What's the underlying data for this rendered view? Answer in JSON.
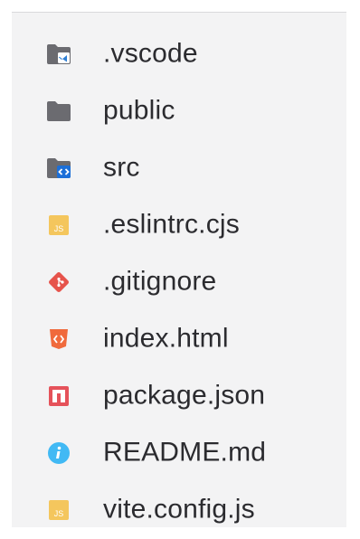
{
  "explorer": {
    "items": [
      {
        "label": ".vscode",
        "icon": "folder-vscode-icon"
      },
      {
        "label": "public",
        "icon": "folder-icon"
      },
      {
        "label": "src",
        "icon": "folder-src-icon"
      },
      {
        "label": ".eslintrc.cjs",
        "icon": "javascript-file-icon"
      },
      {
        "label": ".gitignore",
        "icon": "git-file-icon"
      },
      {
        "label": "index.html",
        "icon": "html-file-icon"
      },
      {
        "label": "package.json",
        "icon": "npm-package-icon"
      },
      {
        "label": "README.md",
        "icon": "info-icon"
      },
      {
        "label": "vite.config.js",
        "icon": "javascript-file-icon"
      }
    ]
  },
  "colors": {
    "folder": "#6b6b70",
    "vscode_blue": "#2f7fd4",
    "src_blue": "#1c6fd8",
    "js_yellow": "#f4c65d",
    "git_red": "#e6534b",
    "html_orange": "#f06a3c",
    "npm_red": "#e5525a",
    "info_cyan": "#41b9f4",
    "text": "#2b2b2f"
  }
}
